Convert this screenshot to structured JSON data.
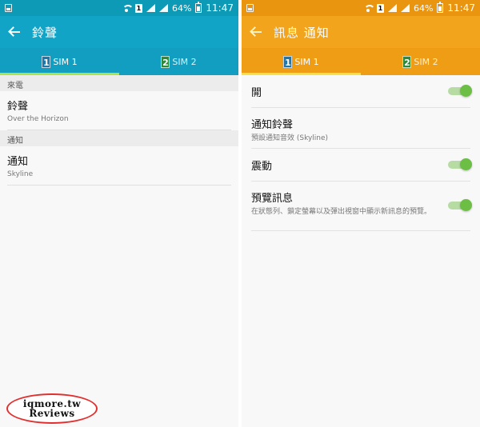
{
  "colors": {
    "left_accent": "#11a4c7",
    "left_tab_bg": "#129ec0",
    "left_indicator": "#a9e44f",
    "right_accent": "#f2a41c",
    "right_tab_bg": "#ef9d14",
    "right_indicator": "#f5e14b",
    "toggle_on": "#6cbe45"
  },
  "status_bar": {
    "battery_percent": "64%",
    "time": "11:47",
    "sim_indicator": "1"
  },
  "left": {
    "title": "鈴聲",
    "tabs": [
      {
        "badge": "1",
        "label": "SIM 1",
        "active": true,
        "badge_color": "#2176a8"
      },
      {
        "badge": "2",
        "label": "SIM 2",
        "active": false,
        "badge_color": "#2c8a3a"
      }
    ],
    "sections": [
      {
        "header": "來電",
        "items": [
          {
            "title": "鈴聲",
            "subtitle": "Over the Horizon"
          }
        ]
      },
      {
        "header": "通知",
        "items": [
          {
            "title": "通知",
            "subtitle": "Skyline"
          }
        ]
      }
    ]
  },
  "right": {
    "title": "訊息 通知",
    "tabs": [
      {
        "badge": "1",
        "label": "SIM 1",
        "active": true,
        "badge_color": "#2176a8"
      },
      {
        "badge": "2",
        "label": "SIM 2",
        "active": false,
        "badge_color": "#2c8a3a"
      }
    ],
    "items": [
      {
        "title": "開",
        "subtitle": "",
        "toggle": true
      },
      {
        "title": "通知鈴聲",
        "subtitle": "預設通知音效 (Skyline)",
        "toggle": false
      },
      {
        "title": "震動",
        "subtitle": "",
        "toggle": true
      },
      {
        "title": "預覽訊息",
        "subtitle": "在狀態列、鎖定螢幕以及彈出視窗中顯示新訊息的預覽。",
        "toggle": true
      }
    ]
  },
  "watermark": {
    "line1": "iqmore.tw",
    "line2": "Reviews"
  }
}
